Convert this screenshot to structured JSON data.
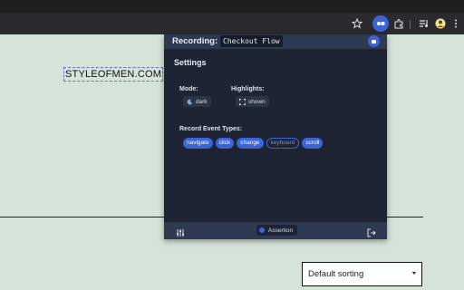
{
  "page": {
    "logo_text": "STYLEOFMEN.COM",
    "sort_value": "Default sorting"
  },
  "popup": {
    "recording_label": "Recording:",
    "recording_name": "Checkout Flow",
    "settings_title": "Settings",
    "mode": {
      "label": "Mode:",
      "value": "dark"
    },
    "highlights": {
      "label": "Highlights:",
      "value": "shown"
    },
    "event_types": {
      "label": "Record Event Types:",
      "items": [
        {
          "label": "navigate",
          "active": true
        },
        {
          "label": "click",
          "active": true
        },
        {
          "label": "change",
          "active": true
        },
        {
          "label": "keyboard",
          "active": false
        },
        {
          "label": "scroll",
          "active": true
        }
      ]
    },
    "footer": {
      "assertion_label": "Assertion"
    }
  },
  "colors": {
    "accent": "#3b64d8",
    "popup_bg": "#1e2433",
    "header_bg": "#2e3a52",
    "page_bg": "#d5e3d9"
  }
}
